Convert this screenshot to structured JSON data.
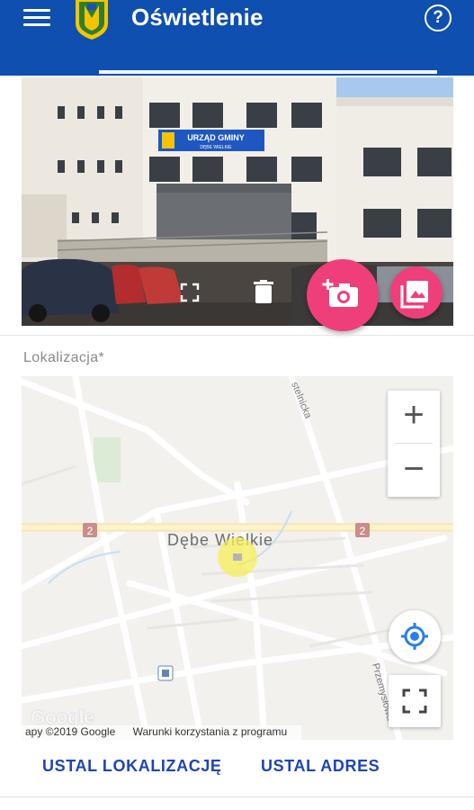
{
  "app_bar": {
    "title": "Oświetlenie",
    "menu_icon": "hamburger-menu-icon",
    "help_icon": "help-circle-icon",
    "help_glyph": "?",
    "color": "#0e4fb0"
  },
  "photo": {
    "sign_line1": "URZĄD GMINY",
    "sign_line2": "DĘBE WIELKIE",
    "expand_icon": "expand-icon",
    "delete_icon": "trash-icon",
    "camera_icon": "add-photo-camera-icon",
    "gallery_icon": "gallery-icon",
    "accent": "#ee3f7a"
  },
  "location": {
    "label": "Lokalizacja*"
  },
  "map": {
    "place_label": "Dębe Wielkie",
    "street_1": "stelnicka",
    "street_2": "Przemysłowa",
    "road_badge_left": "2",
    "road_badge_right": "2",
    "zoom_in": "+",
    "zoom_out": "−",
    "attribution": "apy ©2019 Google",
    "terms": "Warunki korzystania z programu",
    "watermark": "Google"
  },
  "actions": {
    "set_location": "USTAL LOKALIZACJĘ",
    "set_address": "USTAL ADRES",
    "color": "#1f44b8"
  }
}
